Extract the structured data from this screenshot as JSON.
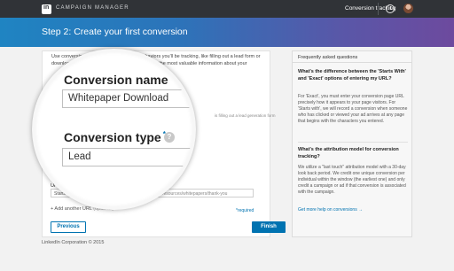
{
  "topbar": {
    "logo_text": "in",
    "app_name": "CAMPAIGN MANAGER",
    "conversion_tracking": "Conversion tracking"
  },
  "banner": {
    "title": "Step 2: Create your first conversion"
  },
  "form": {
    "intro_text": "Use conversion tracking to measure key behaviors you'll be tracking, like filling out a lead form or downloading a whitepaper. We'll help us give you the most valuable information about your",
    "lead_form_note": "is filling out a lead generation form",
    "conversion_name_label": "Conversion name",
    "conversion_name_value": "Whitepaper Download",
    "conversion_type_label": "Conversion type",
    "required_star": "*",
    "help_glyph": "?",
    "conversion_type_value": "Lead",
    "url_label": "URL",
    "url_match_value": "Starts with",
    "url_value": "linkedin.com/marketing-resources/whitepapers/thank-you",
    "add_url_label": "+ Add another URL",
    "add_url_optional": "(optional)",
    "required_note": "*required",
    "previous_label": "Previous",
    "finish_label": "Finish"
  },
  "footer": {
    "copyright": "LinkedIn Corporation © 2015"
  },
  "faq": {
    "header": "Frequently asked questions",
    "q1": "What's the difference between the 'Starts With' and 'Exact' options of entering my URL?",
    "a1": "For 'Exact', you must enter your conversion page URL precisely how it appears to your page visitors. For 'Starts with', we will record a conversion when someone who has clicked or viewed your ad arrives at any page that begins with the characters you entered.",
    "q2": "What's the attribution model for conversion tracking?",
    "a2": "We utilize a \"last touch\" attribution model with a 30-day look back period. We credit one unique conversion per individual within the window (the earliest one) and only credit a campaign or ad if that conversion is associated with the campaign.",
    "more_link": "Get more help on conversions →"
  }
}
